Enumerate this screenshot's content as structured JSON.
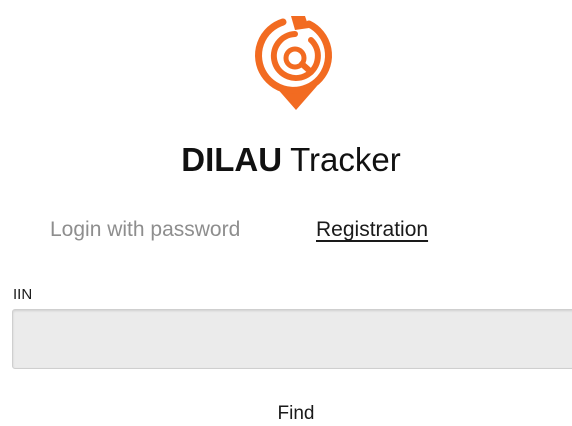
{
  "app": {
    "logo_icon": "location-pin-search-icon",
    "brand_color": "#f26b21",
    "title_bold": "DILAU",
    "title_rest": "Tracker"
  },
  "tabs": {
    "login_label": "Login with password",
    "registration_label": "Registration",
    "active": "Registration"
  },
  "form": {
    "iin_label": "IIN",
    "iin_value": "",
    "iin_placeholder": "",
    "find_label": "Find"
  }
}
